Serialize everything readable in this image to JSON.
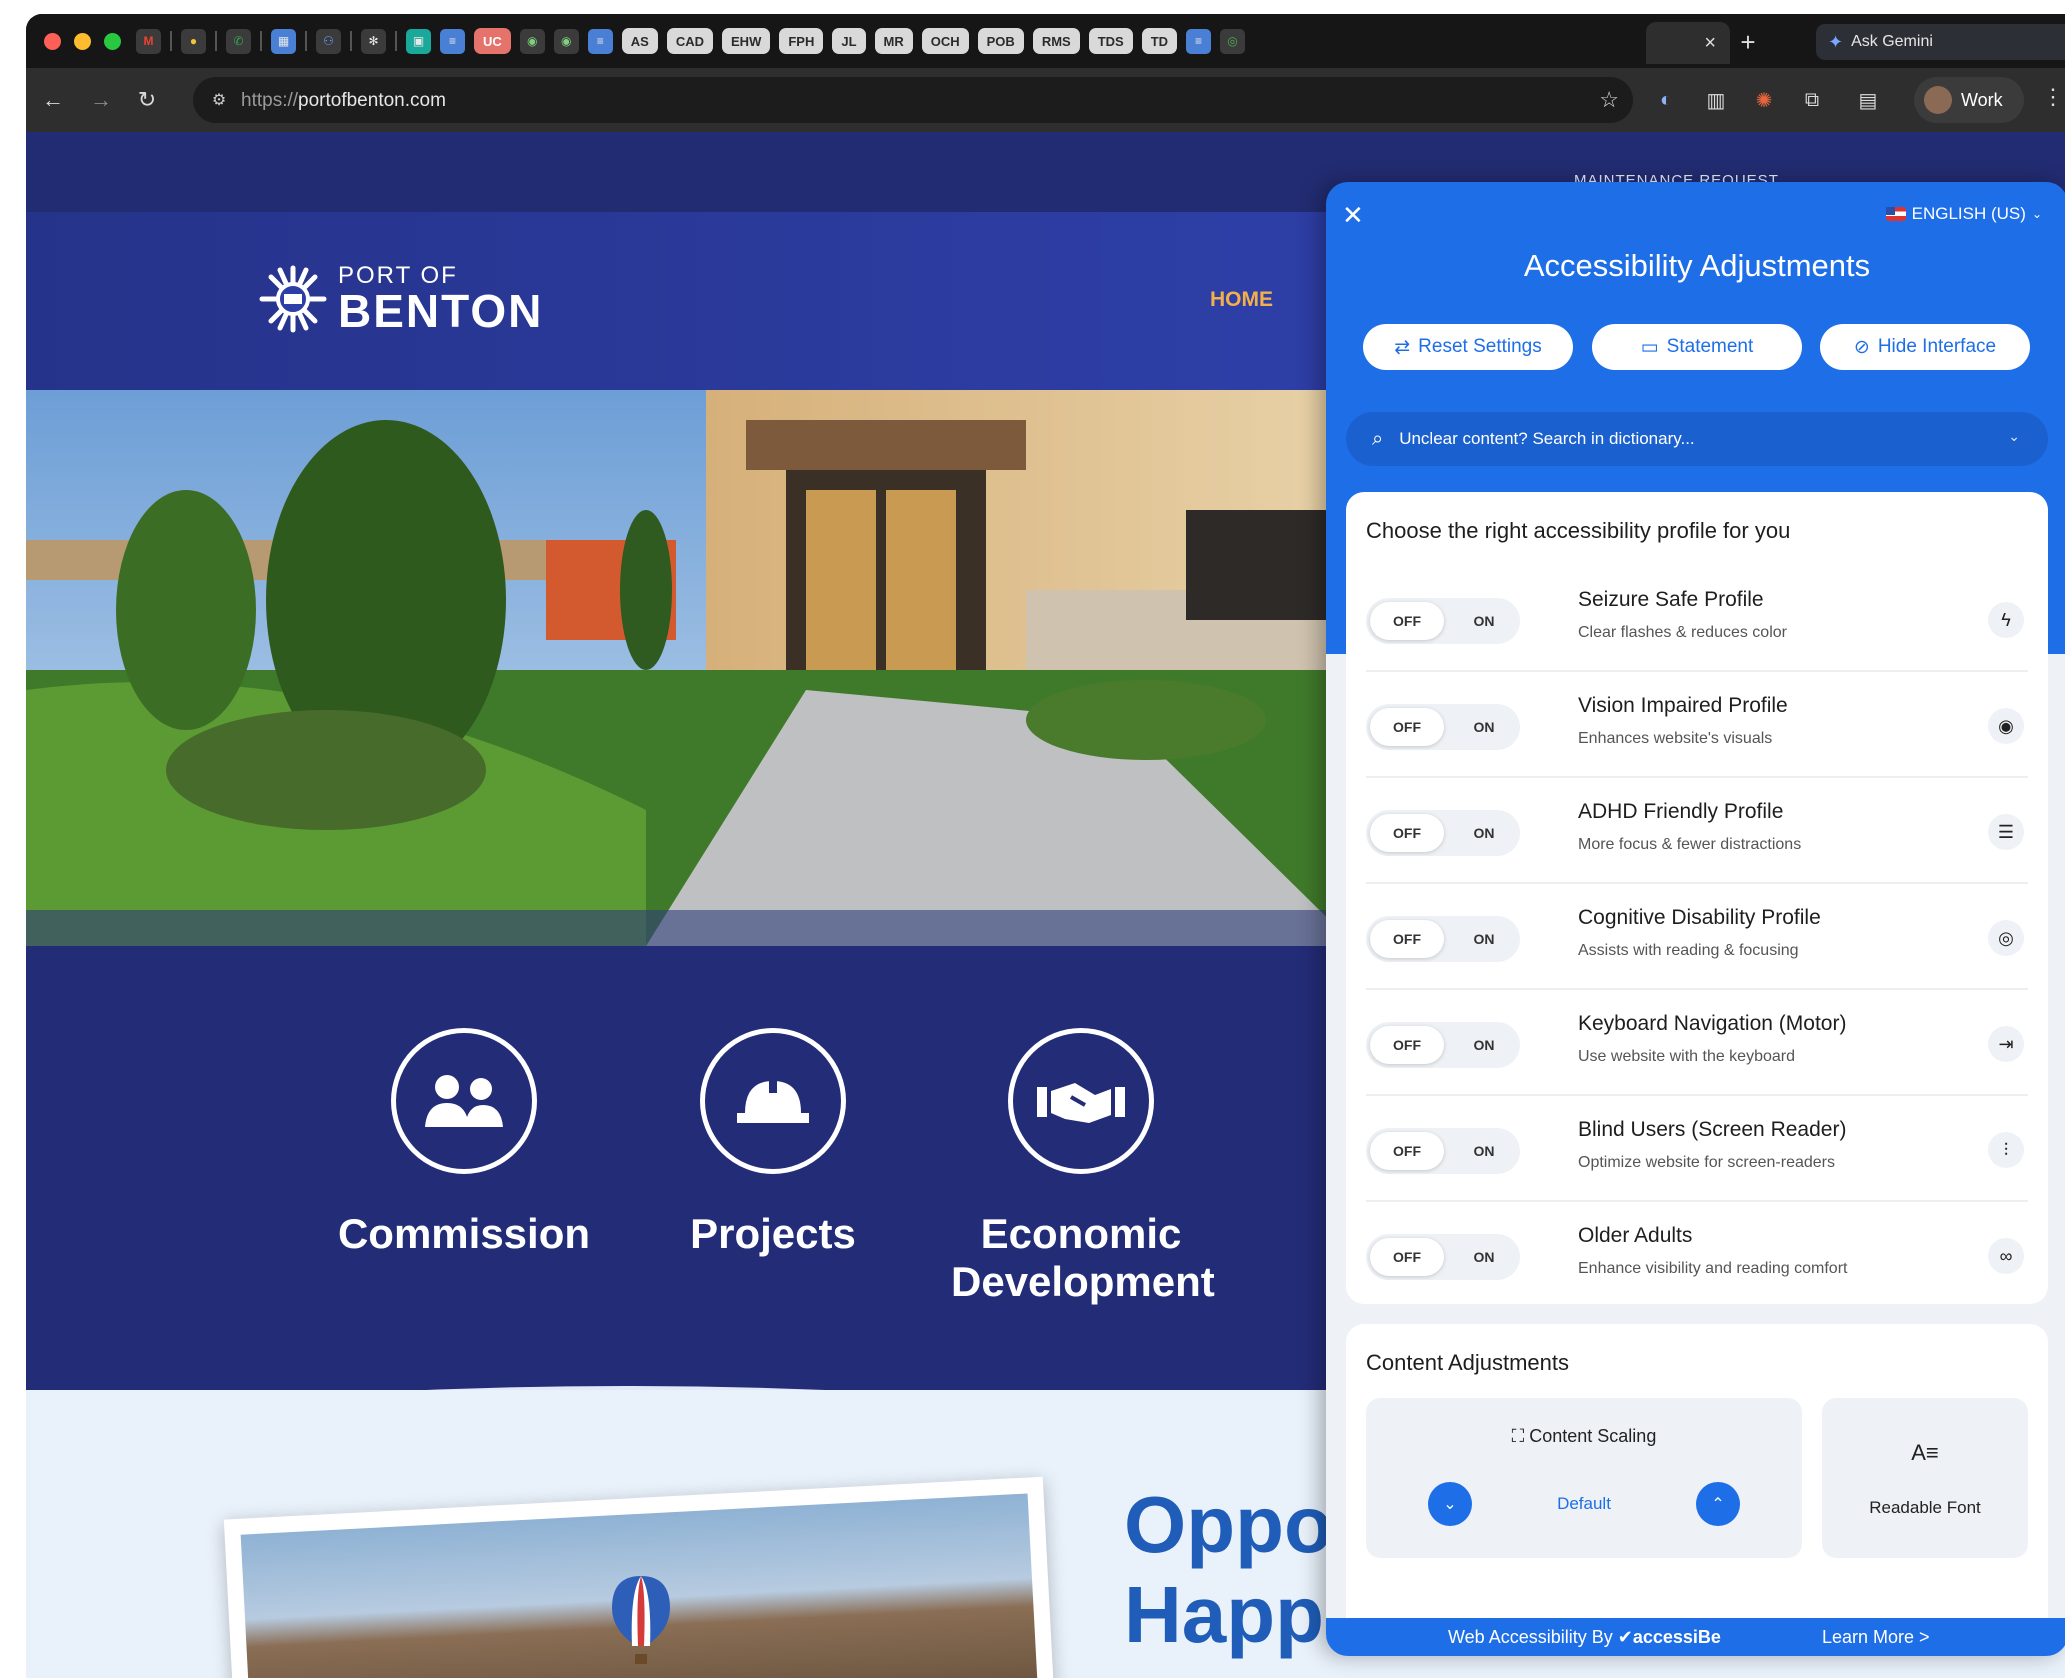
{
  "browser": {
    "tab_pills": [
      "UC",
      "AS",
      "CAD",
      "EHW",
      "FPH",
      "JL",
      "MR",
      "OCH",
      "POB",
      "RMS",
      "TDS",
      "TD"
    ],
    "active_tab_close": "×",
    "new_tab": "+",
    "gemini_label": "Ask Gemini",
    "url_protocol": "https://",
    "url_host": "portofbenton.com",
    "profile_label": "Work"
  },
  "site": {
    "maintenance_link": "MAINTENANCE REQUEST",
    "logo_small": "PORT OF",
    "logo_big": "BENTON",
    "nav_home": "HOME",
    "features": [
      {
        "label": "Commission",
        "icon": "people-icon"
      },
      {
        "label": "Projects",
        "icon": "hardhat-icon"
      },
      {
        "label": "Economic Development",
        "icon": "handshake-icon"
      }
    ],
    "headline_line1": "Opportunity",
    "headline_line2": "Happens Here!"
  },
  "panel": {
    "close": "✕",
    "language": "ENGLISH (US)",
    "title": "Accessibility Adjustments",
    "buttons": {
      "reset": "Reset Settings",
      "statement": "Statement",
      "hide": "Hide Interface"
    },
    "dictionary_placeholder": "Unclear content? Search in dictionary...",
    "profiles_title": "Choose the right accessibility profile for you",
    "toggle_off": "OFF",
    "toggle_on": "ON",
    "profiles": [
      {
        "name": "Seizure Safe Profile",
        "desc": "Clear flashes & reduces color",
        "icon": "bolt-icon"
      },
      {
        "name": "Vision Impaired Profile",
        "desc": "Enhances website's visuals",
        "icon": "eye-icon"
      },
      {
        "name": "ADHD Friendly Profile",
        "desc": "More focus & fewer distractions",
        "icon": "focus-icon"
      },
      {
        "name": "Cognitive Disability Profile",
        "desc": "Assists with reading & focusing",
        "icon": "target-icon"
      },
      {
        "name": "Keyboard Navigation (Motor)",
        "desc": "Use website with the keyboard",
        "icon": "arrow-bar-icon"
      },
      {
        "name": "Blind Users (Screen Reader)",
        "desc": "Optimize website for screen-readers",
        "icon": "audio-wave-icon"
      },
      {
        "name": "Older Adults",
        "desc": "Enhance visibility and reading comfort",
        "icon": "glasses-icon"
      }
    ],
    "content_title": "Content Adjustments",
    "content_scaling_label": "Content Scaling",
    "content_scaling_value": "Default",
    "readable_font_label": "Readable Font",
    "footer_by": "Web Accessibility By",
    "footer_brand": "accessiBe",
    "footer_more": "Learn More >"
  },
  "colors": {
    "site_navy": "#243078",
    "panel_blue": "#1e6ee8",
    "nav_orange": "#f3b04a",
    "headline_blue": "#1f5db8"
  }
}
